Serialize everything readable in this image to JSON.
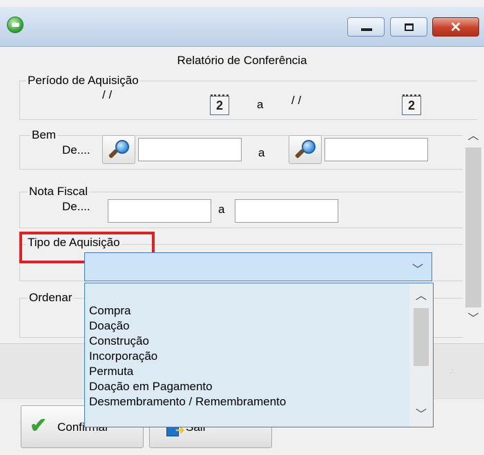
{
  "window": {
    "buttons": {
      "minimize_icon": "minimize-icon",
      "maximize_icon": "maximize-icon",
      "close_label": "✕"
    }
  },
  "form": {
    "title": "Relatório de Conferência",
    "periodo": {
      "legend": "Período de Aquisição",
      "from_value": "/ /",
      "to_label": "a",
      "to_value": "/ /",
      "calendar_label": "2"
    },
    "bem": {
      "legend": "Bem",
      "from_label": "De....",
      "to_label": "a",
      "from_value": "",
      "to_value": ""
    },
    "nota_fiscal": {
      "legend": "Nota Fiscal",
      "from_label": "De....",
      "to_label": "a",
      "from_value": "",
      "to_value": ""
    },
    "tipo": {
      "legend": "Tipo de Aquisição",
      "selected": ""
    },
    "ordenar": {
      "legend": "Ordenar"
    }
  },
  "dropdown": {
    "options": [
      "",
      "Compra",
      "Doação",
      "Construção",
      "Incorporação",
      "Permuta",
      "Doação em Pagamento",
      "Desmembramento / Remembramento"
    ]
  },
  "buttons": {
    "confirm_label": "Confirmar",
    "exit_label": "Sair"
  },
  "colors": {
    "highlight": "#e41d22",
    "combo_bg": "#cce4f7",
    "dropdown_bg": "#dceaf3"
  }
}
